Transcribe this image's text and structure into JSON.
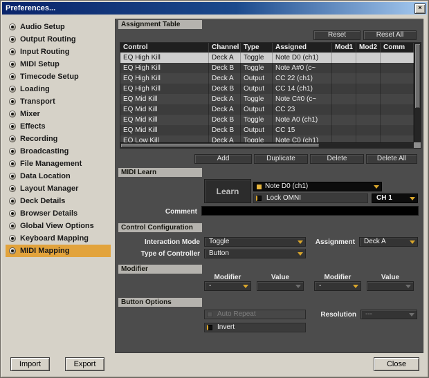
{
  "window": {
    "title": "Preferences...",
    "close_glyph": "×"
  },
  "colors": {
    "accent": "#E2A33C",
    "titlebar_left": "#0A246A",
    "titlebar_right": "#A6CAF0",
    "panel": "#4C4C4C",
    "selection": "#CECECE"
  },
  "sidebar": {
    "items": [
      {
        "label": "Audio Setup",
        "selected": false
      },
      {
        "label": "Output Routing",
        "selected": false
      },
      {
        "label": "Input Routing",
        "selected": false
      },
      {
        "label": "MIDI Setup",
        "selected": false
      },
      {
        "label": "Timecode Setup",
        "selected": false
      },
      {
        "label": "Loading",
        "selected": false
      },
      {
        "label": "Transport",
        "selected": false
      },
      {
        "label": "Mixer",
        "selected": false
      },
      {
        "label": "Effects",
        "selected": false
      },
      {
        "label": "Recording",
        "selected": false
      },
      {
        "label": "Broadcasting",
        "selected": false
      },
      {
        "label": "File Management",
        "selected": false
      },
      {
        "label": "Data Location",
        "selected": false
      },
      {
        "label": "Layout Manager",
        "selected": false
      },
      {
        "label": "Deck Details",
        "selected": false
      },
      {
        "label": "Browser Details",
        "selected": false
      },
      {
        "label": "Global View Options",
        "selected": false
      },
      {
        "label": "Keyboard Mapping",
        "selected": false
      },
      {
        "label": "MIDI Mapping",
        "selected": true
      }
    ]
  },
  "assignment_table": {
    "header": "Assignment Table",
    "reset_label": "Reset",
    "reset_all_label": "Reset All",
    "columns": [
      "Control",
      "Channel",
      "Type",
      "Assigned",
      "Mod1",
      "Mod2",
      "Comm"
    ],
    "rows": [
      {
        "control": "EQ High Kill",
        "channel": "Deck A",
        "type": "Toggle",
        "assigned": "Note D0 (ch1)",
        "mod1": "",
        "mod2": "",
        "comment": ""
      },
      {
        "control": "EQ High Kill",
        "channel": "Deck B",
        "type": "Toggle",
        "assigned": "Note A#0 (c~",
        "mod1": "",
        "mod2": "",
        "comment": ""
      },
      {
        "control": "EQ High Kill",
        "channel": "Deck A",
        "type": "Output",
        "assigned": "CC 22 (ch1)",
        "mod1": "",
        "mod2": "",
        "comment": ""
      },
      {
        "control": "EQ High Kill",
        "channel": "Deck B",
        "type": "Output",
        "assigned": "CC 14 (ch1)",
        "mod1": "",
        "mod2": "",
        "comment": ""
      },
      {
        "control": "EQ Mid Kill",
        "channel": "Deck A",
        "type": "Toggle",
        "assigned": "Note C#0 (c~",
        "mod1": "",
        "mod2": "",
        "comment": ""
      },
      {
        "control": "EQ Mid Kill",
        "channel": "Deck A",
        "type": "Output",
        "assigned": "CC 23",
        "mod1": "",
        "mod2": "",
        "comment": ""
      },
      {
        "control": "EQ Mid Kill",
        "channel": "Deck B",
        "type": "Toggle",
        "assigned": "Note A0 (ch1)",
        "mod1": "",
        "mod2": "",
        "comment": ""
      },
      {
        "control": "EQ Mid Kill",
        "channel": "Deck B",
        "type": "Output",
        "assigned": "CC 15",
        "mod1": "",
        "mod2": "",
        "comment": ""
      },
      {
        "control": "EQ Low Kill",
        "channel": "Deck A",
        "type": "Toggle",
        "assigned": "Note C0 (ch1)",
        "mod1": "",
        "mod2": "",
        "comment": ""
      }
    ],
    "add_label": "Add",
    "duplicate_label": "Duplicate",
    "delete_label": "Delete",
    "delete_all_label": "Delete All"
  },
  "midi_learn": {
    "header": "MIDI Learn",
    "learn_label": "Learn",
    "assignment_value": "Note D0 (ch1)",
    "lock_omni_label": "Lock OMNI",
    "channel_value": "CH 1",
    "comment_label": "Comment",
    "comment_value": ""
  },
  "control_configuration": {
    "header": "Control Configuration",
    "interaction_mode_label": "Interaction Mode",
    "interaction_mode_value": "Toggle",
    "assignment_label": "Assignment",
    "assignment_value": "Deck A",
    "type_of_controller_label": "Type of Controller",
    "type_of_controller_value": "Button"
  },
  "modifier": {
    "header": "Modifier",
    "modifier1_label": "Modifier",
    "value1_label": "Value",
    "modifier2_label": "Modifier",
    "value2_label": "Value",
    "modifier1_value": "-",
    "value1_value": "",
    "modifier2_value": "-",
    "value2_value": ""
  },
  "button_options": {
    "header": "Button Options",
    "auto_repeat_label": "Auto Repeat",
    "resolution_label": "Resolution",
    "resolution_value": "---",
    "invert_label": "Invert"
  },
  "footer": {
    "import_label": "Import",
    "export_label": "Export",
    "close_label": "Close"
  }
}
